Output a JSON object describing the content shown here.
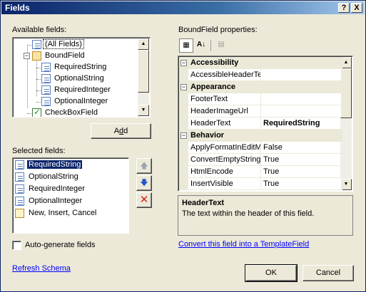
{
  "window": {
    "title": "Fields",
    "help_button": "?",
    "close_button": "X"
  },
  "available": {
    "label": "Available fields:",
    "items": [
      {
        "label": "(All Fields)",
        "level": 0,
        "icon": "field-icon"
      },
      {
        "label": "BoundField",
        "level": 0,
        "icon": "boundfield-icon",
        "expanded": true
      },
      {
        "label": "RequiredString",
        "level": 1,
        "icon": "field-icon"
      },
      {
        "label": "OptionalString",
        "level": 1,
        "icon": "field-icon"
      },
      {
        "label": "RequiredInteger",
        "level": 1,
        "icon": "field-icon"
      },
      {
        "label": "OptionalInteger",
        "level": 1,
        "icon": "field-icon"
      },
      {
        "label": "CheckBoxField",
        "level": 0,
        "icon": "checkboxfield-icon"
      }
    ]
  },
  "add_button": "Add",
  "add_button_mnemonic": "d",
  "selected": {
    "label": "Selected fields:",
    "items": [
      {
        "label": "RequiredString",
        "selected": true,
        "icon": "field-icon"
      },
      {
        "label": "OptionalString",
        "selected": false,
        "icon": "field-icon"
      },
      {
        "label": "RequiredInteger",
        "selected": false,
        "icon": "field-icon"
      },
      {
        "label": "OptionalInteger",
        "selected": false,
        "icon": "field-icon"
      },
      {
        "label": "New, Insert, Cancel",
        "selected": false,
        "icon": "commandfield-icon"
      }
    ]
  },
  "move_up_icon": "arrow-up-icon",
  "move_down_icon": "arrow-down-icon",
  "delete_icon": "delete-x-icon",
  "autogenerate": {
    "label": "Auto-generate fields",
    "checked": false
  },
  "refresh_schema_link": "Refresh Schema",
  "properties": {
    "label": "BoundField properties:",
    "toolbar": [
      "categorized-icon",
      "alphabetical-icon",
      "property-pages-icon"
    ],
    "rows": [
      {
        "type": "category",
        "name": "Accessibility"
      },
      {
        "type": "prop",
        "name": "AccessibleHeaderTe",
        "value": ""
      },
      {
        "type": "category",
        "name": "Appearance"
      },
      {
        "type": "prop",
        "name": "FooterText",
        "value": ""
      },
      {
        "type": "prop",
        "name": "HeaderImageUrl",
        "value": ""
      },
      {
        "type": "prop",
        "name": "HeaderText",
        "value": "RequiredString",
        "selected": true
      },
      {
        "type": "category",
        "name": "Behavior"
      },
      {
        "type": "prop",
        "name": "ApplyFormatInEditM",
        "value": "False"
      },
      {
        "type": "prop",
        "name": "ConvertEmptyString",
        "value": "True"
      },
      {
        "type": "prop",
        "name": "HtmlEncode",
        "value": "True"
      },
      {
        "type": "prop",
        "name": "InsertVisible",
        "value": "True"
      }
    ],
    "description_title": "HeaderText",
    "description_text": "The text within the header of this field."
  },
  "convert_link": "Convert this field into a TemplateField",
  "ok_button": "OK",
  "cancel_button": "Cancel"
}
